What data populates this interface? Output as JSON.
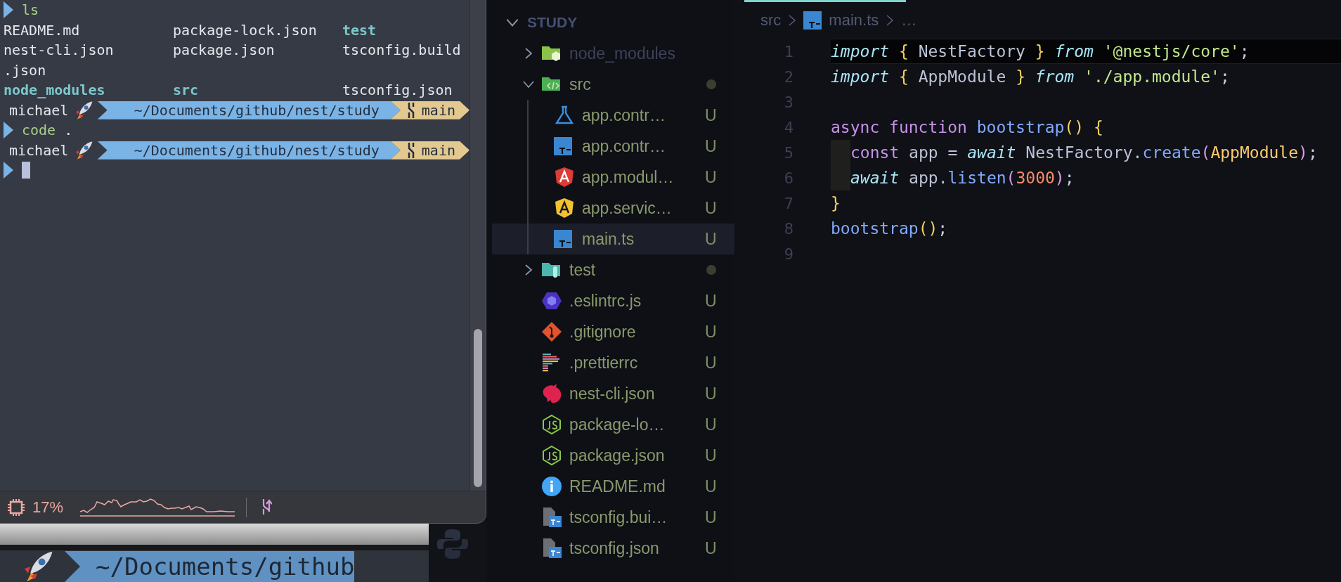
{
  "terminal": {
    "lines": [
      {
        "kind": "command",
        "program": "ls"
      },
      {
        "kind": "listing",
        "entries": [
          {
            "name": "README.md",
            "kind": "file"
          },
          {
            "name": "package-lock.json",
            "kind": "file"
          },
          {
            "name": "test",
            "kind": "dir"
          }
        ]
      },
      {
        "kind": "listing",
        "entries": [
          {
            "name": "nest-cli.json",
            "kind": "file"
          },
          {
            "name": "package.json",
            "kind": "file"
          },
          {
            "name": "tsconfig.build",
            "kind": "file"
          }
        ]
      },
      {
        "kind": "listing",
        "entries": [
          {
            "name": ".json",
            "kind": "file"
          }
        ]
      },
      {
        "kind": "listing",
        "entries": [
          {
            "name": "node_modules",
            "kind": "dir"
          },
          {
            "name": "src",
            "kind": "dir"
          },
          {
            "name": "tsconfig.json",
            "kind": "file"
          }
        ]
      },
      {
        "kind": "prompt",
        "user": "michael",
        "path": "~/Documents/github/nest/study",
        "branch": "main"
      },
      {
        "kind": "command",
        "program": "code",
        "args": "."
      },
      {
        "kind": "prompt",
        "user": "michael",
        "path": "~/Documents/github/nest/study",
        "branch": "main"
      },
      {
        "kind": "input"
      }
    ],
    "status_bar": {
      "cpu": "17%"
    }
  },
  "background_terminal": {
    "path": "~/Documents/github"
  },
  "explorer": {
    "title": "STUDY",
    "expanded": true,
    "items": [
      {
        "name": "node_modules",
        "kind": "folder_modules",
        "expanded": false,
        "ignored": true,
        "modified": false,
        "selected": false
      },
      {
        "name": "src",
        "kind": "folder_source",
        "expanded": true,
        "ignored": false,
        "modified": true,
        "selected": false,
        "children": [
          {
            "name": "app.contr…",
            "kind": "spec",
            "status": "U",
            "ignored": false,
            "selected": false
          },
          {
            "name": "app.contr…",
            "kind": "typescript",
            "status": "U",
            "ignored": false,
            "selected": false
          },
          {
            "name": "app.modul…",
            "kind": "module",
            "status": "U",
            "ignored": false,
            "selected": false
          },
          {
            "name": "app.servic…",
            "kind": "service",
            "status": "U",
            "ignored": false,
            "selected": false
          },
          {
            "name": "main.ts",
            "kind": "typescript",
            "status": "U",
            "ignored": false,
            "selected": true
          }
        ]
      },
      {
        "name": "test",
        "kind": "folder_test",
        "expanded": false,
        "ignored": false,
        "modified": true,
        "selected": false
      },
      {
        "name": ".eslintrc.js",
        "kind": "lint",
        "status": "U",
        "ignored": false,
        "selected": false
      },
      {
        "name": ".gitignore",
        "kind": "gitignore",
        "status": "U",
        "ignored": false,
        "selected": false
      },
      {
        "name": ".prettierrc",
        "kind": "format",
        "status": "U",
        "ignored": false,
        "selected": false
      },
      {
        "name": "nest-cli.json",
        "kind": "cli",
        "status": "U",
        "ignored": false,
        "selected": false
      },
      {
        "name": "package-lo…",
        "kind": "package",
        "status": "U",
        "ignored": false,
        "selected": false
      },
      {
        "name": "package.json",
        "kind": "package",
        "status": "U",
        "ignored": false,
        "selected": false
      },
      {
        "name": "README.md",
        "kind": "readme",
        "status": "U",
        "ignored": false,
        "selected": false
      },
      {
        "name": "tsconfig.bui…",
        "kind": "tsconfig",
        "status": "U",
        "ignored": false,
        "selected": false
      },
      {
        "name": "tsconfig.json",
        "kind": "tsconfig",
        "status": "U",
        "ignored": false,
        "selected": false
      }
    ]
  },
  "editor": {
    "breadcrumb": [
      {
        "label": "src",
        "kind": "folder"
      },
      {
        "label": "main.ts",
        "kind": "typescript"
      },
      {
        "label": "…",
        "kind": "more"
      }
    ],
    "lines": [
      {
        "number": "1",
        "current": true,
        "indented": false,
        "tokens": [
          {
            "text": "import",
            "kind": "keyword"
          },
          {
            "text": " {",
            "kind": "brace"
          },
          {
            "text": " NestFactory ",
            "kind": "ident"
          },
          {
            "text": "} ",
            "kind": "brace"
          },
          {
            "text": "from",
            "kind": "keyword"
          },
          {
            "text": " '@nestjs/core'",
            "kind": "string"
          },
          {
            "text": ";",
            "kind": "punct"
          }
        ]
      },
      {
        "number": "2",
        "current": false,
        "indented": false,
        "tokens": [
          {
            "text": "import",
            "kind": "keyword"
          },
          {
            "text": " {",
            "kind": "brace"
          },
          {
            "text": " AppModule ",
            "kind": "ident"
          },
          {
            "text": "} ",
            "kind": "brace"
          },
          {
            "text": "from",
            "kind": "keyword"
          },
          {
            "text": " './app.module'",
            "kind": "string"
          },
          {
            "text": ";",
            "kind": "punct"
          }
        ]
      },
      {
        "number": "3",
        "current": false,
        "indented": false
      },
      {
        "number": "4",
        "current": false,
        "indented": false,
        "tokens": [
          {
            "text": "async function ",
            "kind": "storage"
          },
          {
            "text": "bootstrap",
            "kind": "function"
          },
          {
            "text": "() {",
            "kind": "brace"
          }
        ]
      },
      {
        "number": "5",
        "current": false,
        "indented": true,
        "tokens": [
          {
            "text": "const",
            "kind": "storage"
          },
          {
            "text": " app = ",
            "kind": "ident"
          },
          {
            "text": "await",
            "kind": "keyword"
          },
          {
            "text": " NestFactory.",
            "kind": "ident"
          },
          {
            "text": "create",
            "kind": "function"
          },
          {
            "text": "(",
            "kind": "paren"
          },
          {
            "text": "AppModule",
            "kind": "class"
          },
          {
            "text": ")",
            "kind": "paren"
          },
          {
            "text": ";",
            "kind": "punct"
          }
        ]
      },
      {
        "number": "6",
        "current": false,
        "indented": true,
        "tokens": [
          {
            "text": "await",
            "kind": "keyword"
          },
          {
            "text": " app.",
            "kind": "ident"
          },
          {
            "text": "listen",
            "kind": "function"
          },
          {
            "text": "(",
            "kind": "paren"
          },
          {
            "text": "3000",
            "kind": "number"
          },
          {
            "text": ")",
            "kind": "paren"
          },
          {
            "text": ";",
            "kind": "punct"
          }
        ]
      },
      {
        "number": "7",
        "current": false,
        "indented": false,
        "tokens": [
          {
            "text": "}",
            "kind": "brace"
          }
        ]
      },
      {
        "number": "8",
        "current": false,
        "indented": false,
        "tokens": [
          {
            "text": "bootstrap",
            "kind": "function"
          },
          {
            "text": "()",
            "kind": "brace"
          },
          {
            "text": ";",
            "kind": "punct"
          }
        ]
      },
      {
        "number": "9",
        "current": false,
        "indented": false
      }
    ]
  }
}
